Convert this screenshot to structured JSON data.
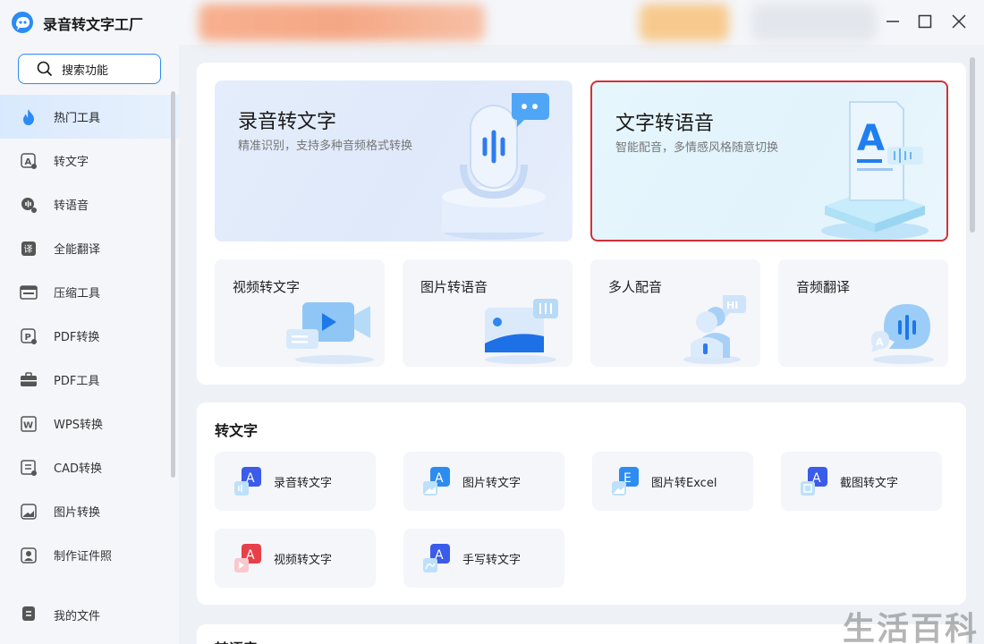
{
  "app": {
    "title": "录音转文字工厂"
  },
  "sidebar": {
    "search_label": "搜索功能",
    "items": [
      {
        "label": "热门工具",
        "icon": "fire-icon",
        "active": true
      },
      {
        "label": "转文字",
        "icon": "text-a-icon"
      },
      {
        "label": "转语音",
        "icon": "voice-icon"
      },
      {
        "label": "全能翻译",
        "icon": "translate-icon"
      },
      {
        "label": "压缩工具",
        "icon": "compress-icon"
      },
      {
        "label": "PDF转换",
        "icon": "pdf-convert-icon"
      },
      {
        "label": "PDF工具",
        "icon": "toolbox-icon"
      },
      {
        "label": "WPS转换",
        "icon": "wps-icon"
      },
      {
        "label": "CAD转换",
        "icon": "cad-icon"
      },
      {
        "label": "图片转换",
        "icon": "image-icon"
      },
      {
        "label": "制作证件照",
        "icon": "id-photo-icon"
      }
    ],
    "bottom_item": {
      "label": "我的文件",
      "icon": "file-icon"
    }
  },
  "hero": [
    {
      "title": "录音转文字",
      "subtitle": "精准识别，支持多种音频格式转换"
    },
    {
      "title": "文字转语音",
      "subtitle": "智能配音，多情感风格随意切换"
    }
  ],
  "cards": [
    {
      "title": "视频转文字"
    },
    {
      "title": "图片转语音"
    },
    {
      "title": "多人配音"
    },
    {
      "title": "音频翻译"
    }
  ],
  "section_text": {
    "title": "转文字",
    "tools": [
      {
        "label": "录音转文字",
        "badge": "A",
        "color": "#3b5bea"
      },
      {
        "label": "图片转文字",
        "badge": "A",
        "color": "#2d8cf0"
      },
      {
        "label": "图片转Excel",
        "badge": "E",
        "color": "#2d8cf0"
      },
      {
        "label": "截图转文字",
        "badge": "A",
        "color": "#3b5bea"
      },
      {
        "label": "视频转文字",
        "badge": "A",
        "color": "#e8404a"
      },
      {
        "label": "手写转文字",
        "badge": "A",
        "color": "#3b5bea"
      }
    ]
  },
  "next_section": {
    "title": "转语音"
  },
  "watermark": "生活百科",
  "colors": {
    "accent": "#2c8bf4",
    "selection": "#d62f36"
  }
}
